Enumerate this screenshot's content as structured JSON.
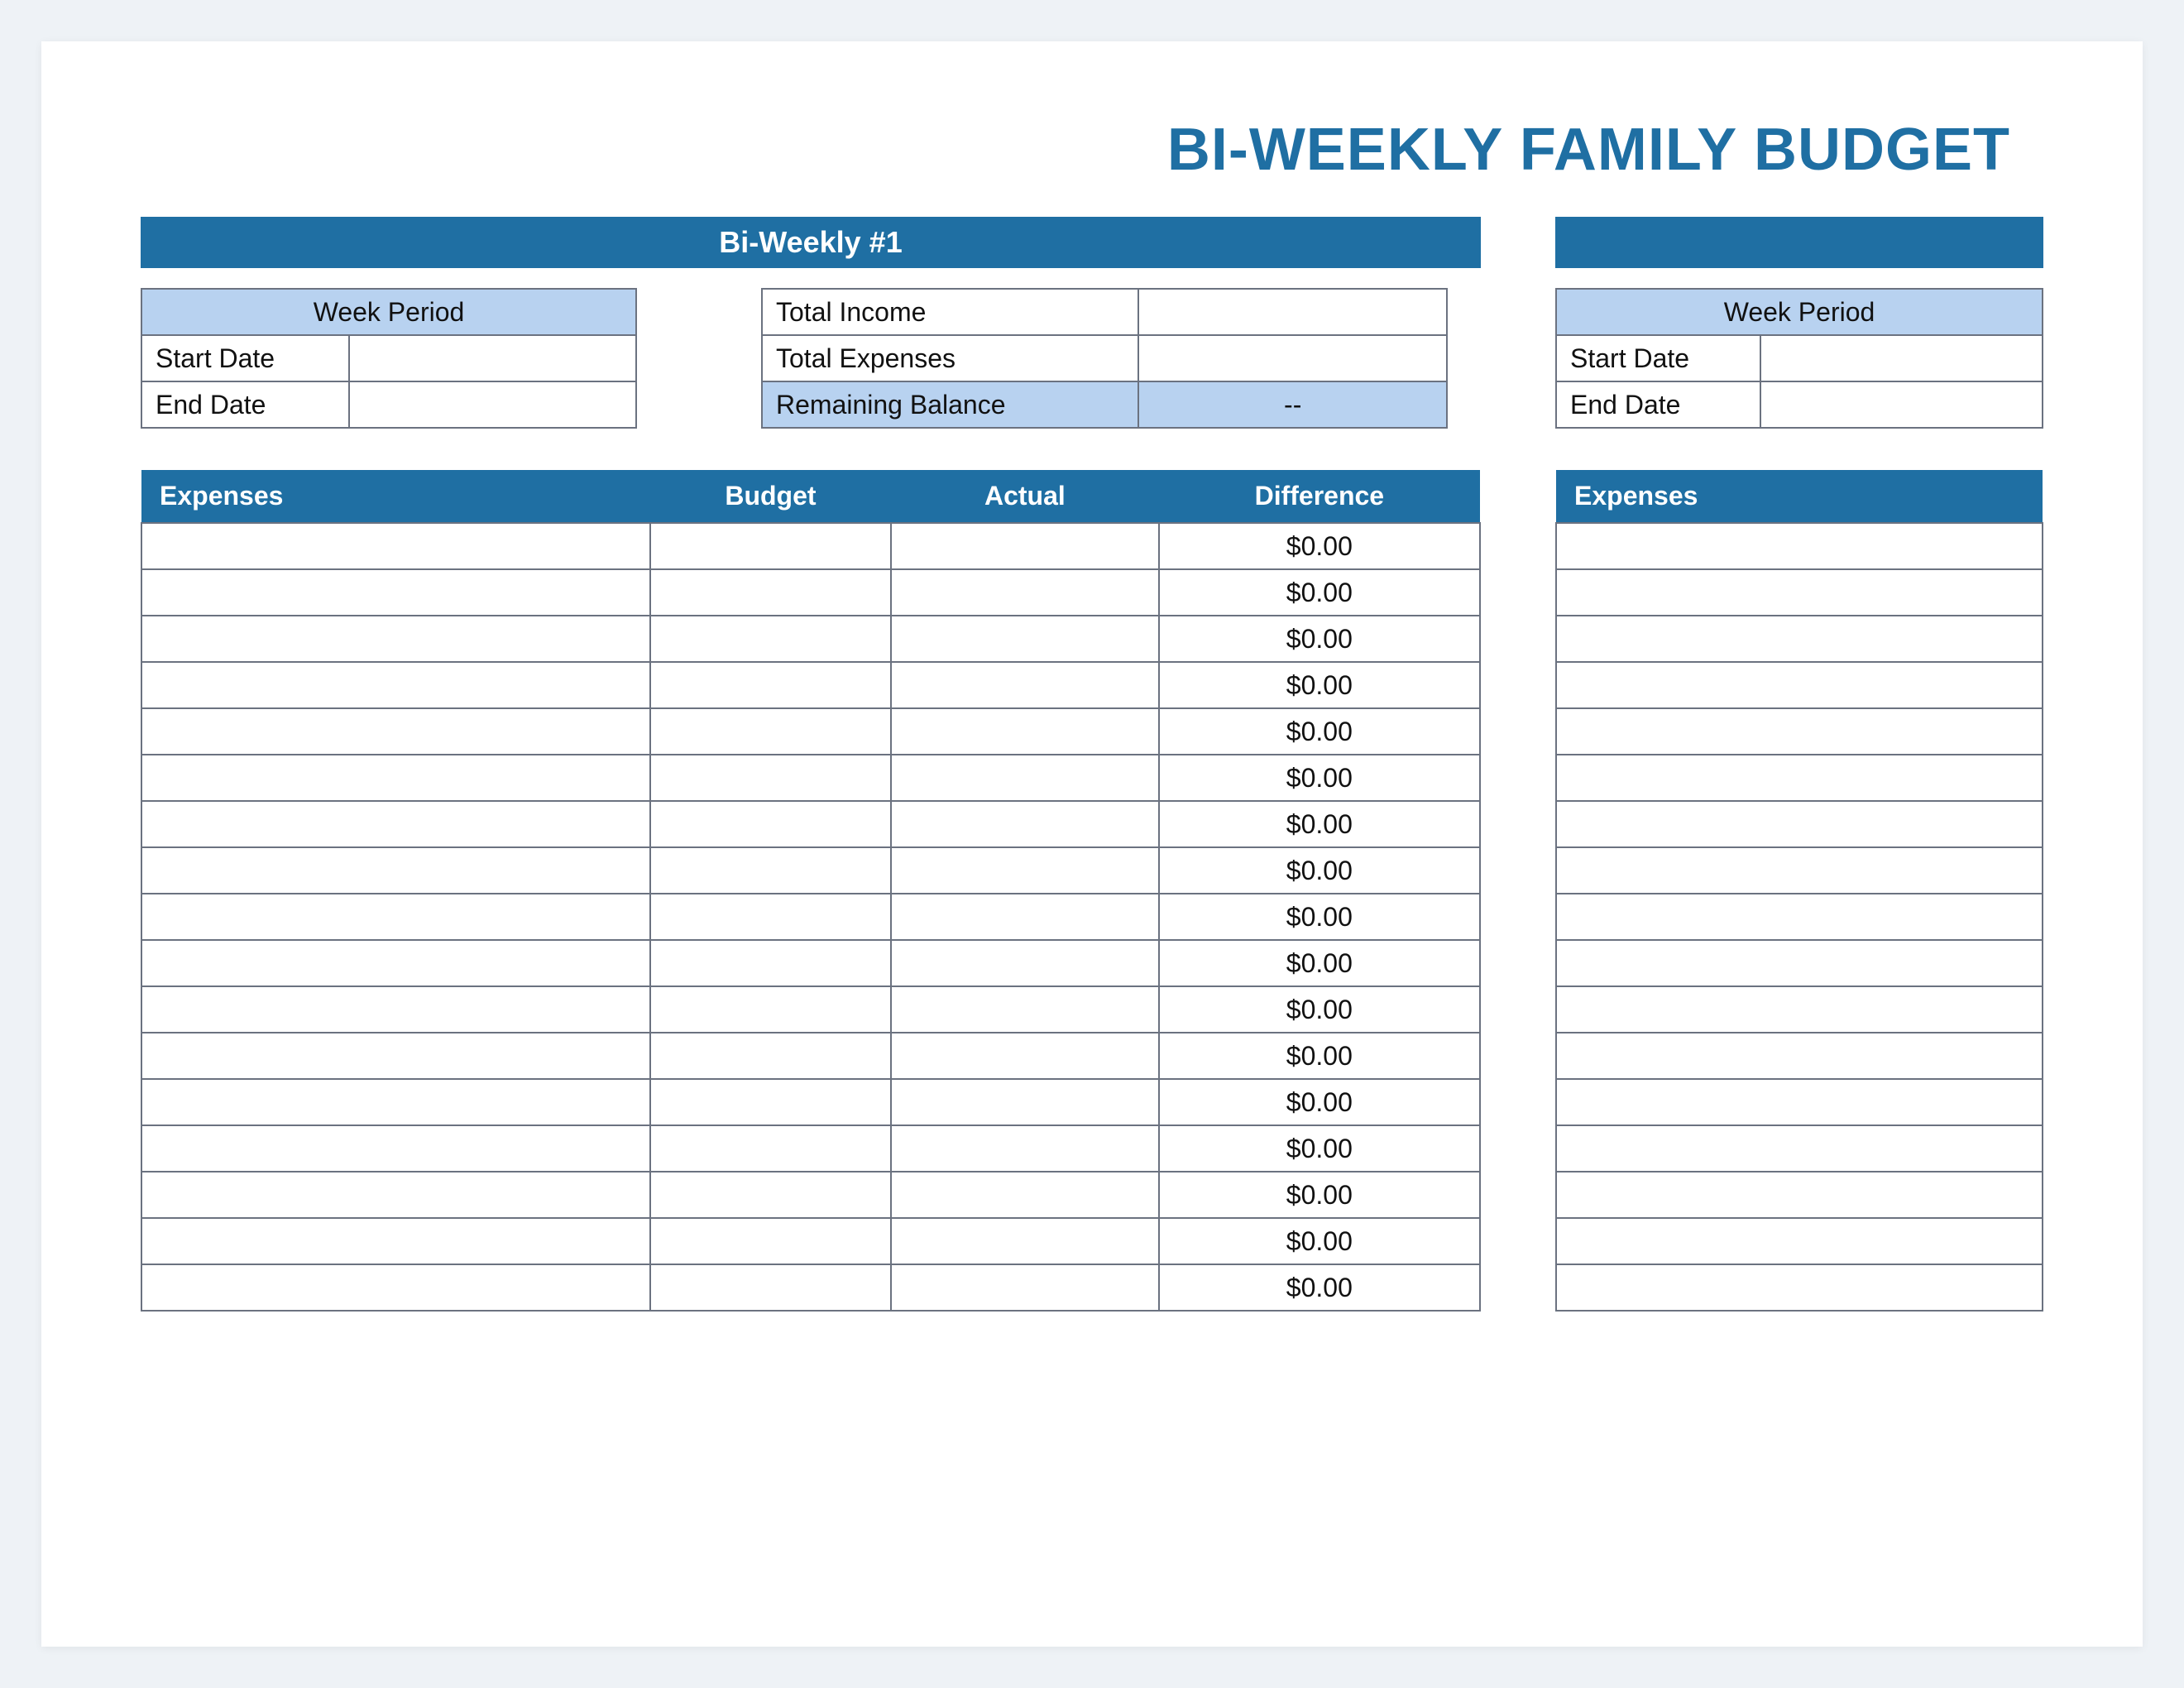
{
  "title": "BI-WEEKLY FAMILY BUDGET",
  "left": {
    "section_header": "Bi-Weekly #1",
    "period": {
      "header": "Week Period",
      "start_label": "Start Date",
      "start_value": "",
      "end_label": "End Date",
      "end_value": ""
    },
    "totals": {
      "income_label": "Total Income",
      "income_value": "",
      "expenses_label": "Total Expenses",
      "expenses_value": "",
      "balance_label": "Remaining Balance",
      "balance_value": "--"
    },
    "table": {
      "headers": {
        "expenses": "Expenses",
        "budget": "Budget",
        "actual": "Actual",
        "difference": "Difference"
      },
      "rows": [
        {
          "expense": "",
          "budget": "",
          "actual": "",
          "difference": "$0.00"
        },
        {
          "expense": "",
          "budget": "",
          "actual": "",
          "difference": "$0.00"
        },
        {
          "expense": "",
          "budget": "",
          "actual": "",
          "difference": "$0.00"
        },
        {
          "expense": "",
          "budget": "",
          "actual": "",
          "difference": "$0.00"
        },
        {
          "expense": "",
          "budget": "",
          "actual": "",
          "difference": "$0.00"
        },
        {
          "expense": "",
          "budget": "",
          "actual": "",
          "difference": "$0.00"
        },
        {
          "expense": "",
          "budget": "",
          "actual": "",
          "difference": "$0.00"
        },
        {
          "expense": "",
          "budget": "",
          "actual": "",
          "difference": "$0.00"
        },
        {
          "expense": "",
          "budget": "",
          "actual": "",
          "difference": "$0.00"
        },
        {
          "expense": "",
          "budget": "",
          "actual": "",
          "difference": "$0.00"
        },
        {
          "expense": "",
          "budget": "",
          "actual": "",
          "difference": "$0.00"
        },
        {
          "expense": "",
          "budget": "",
          "actual": "",
          "difference": "$0.00"
        },
        {
          "expense": "",
          "budget": "",
          "actual": "",
          "difference": "$0.00"
        },
        {
          "expense": "",
          "budget": "",
          "actual": "",
          "difference": "$0.00"
        },
        {
          "expense": "",
          "budget": "",
          "actual": "",
          "difference": "$0.00"
        },
        {
          "expense": "",
          "budget": "",
          "actual": "",
          "difference": "$0.00"
        },
        {
          "expense": "",
          "budget": "",
          "actual": "",
          "difference": "$0.00"
        }
      ]
    }
  },
  "right": {
    "period": {
      "header": "Week Period",
      "start_label": "Start Date",
      "start_value": "",
      "end_label": "End Date",
      "end_value": ""
    },
    "table": {
      "headers": {
        "expenses": "Expenses"
      },
      "row_count": 17
    }
  }
}
